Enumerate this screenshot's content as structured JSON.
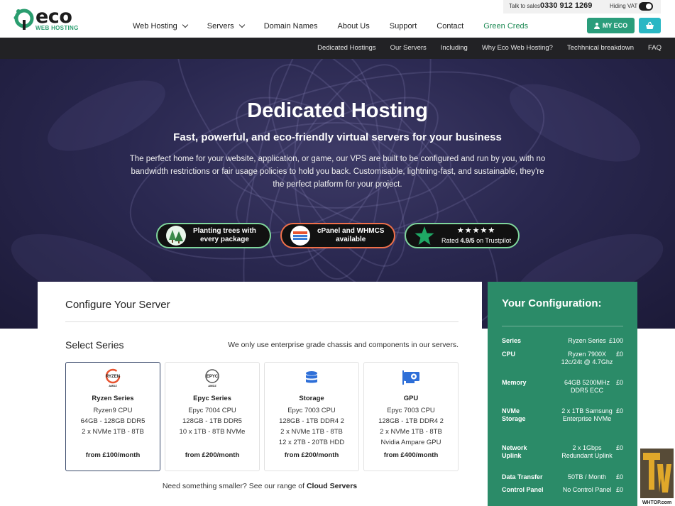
{
  "brand": {
    "word": "eco",
    "sub": "WEB HOSTING"
  },
  "utility": {
    "sales_label": "Talk to sales",
    "phone": "0330 912 1269",
    "vat_label": "Hiding VAT"
  },
  "nav": {
    "items": [
      {
        "label": "Web Hosting",
        "dropdown": true
      },
      {
        "label": "Servers",
        "dropdown": true
      },
      {
        "label": "Domain Names",
        "dropdown": false
      },
      {
        "label": "About Us",
        "dropdown": false
      },
      {
        "label": "Support",
        "dropdown": false
      },
      {
        "label": "Contact",
        "dropdown": false
      },
      {
        "label": "Green Creds",
        "dropdown": false
      }
    ],
    "my_eco_label": "MY ECO"
  },
  "subnav": {
    "links": [
      "Dedicated Hostings",
      "Our Servers",
      "Including",
      "Why Eco Web Hosting?",
      "Techhnical breakdown",
      "FAQ"
    ]
  },
  "hero": {
    "title": "Dedicated Hosting",
    "subtitle": "Fast, powerful, and eco-friendly virtual servers for your business",
    "body": "The perfect home for your website, application, or game, our VPS are built to be configured and run by you, with no bandwidth restrictions or fair usage policies to hold you back. Customisable, lightning-fast, and sustainable, they're the perfect platform for your project.",
    "badges": {
      "trees_line1": "Planting trees with",
      "trees_line2": "every package",
      "cpanel_line1": "cPanel and WHMCS",
      "cpanel_line2": "available",
      "trustpilot_stars": "★★★★★",
      "trustpilot_prefix": "Rated ",
      "trustpilot_rating": "4.9/5",
      "trustpilot_suffix": " on Trustpilot"
    }
  },
  "configure": {
    "title": "Configure Your Server",
    "select_label": "Select Series",
    "note": "We only use enterprise grade chassis and components in our servers.",
    "cards": [
      {
        "name": "Ryzen Series",
        "specs": [
          "Ryzen9 CPU",
          "64GB - 128GB DDR5",
          "2 x NVMe 1TB - 8TB"
        ],
        "price": "from £100/month",
        "icon": "ryzen-logo-icon",
        "icon_text": "RYZEN",
        "icon_sub": "AMDZ",
        "selected": true
      },
      {
        "name": "Epyc Series",
        "specs": [
          "Epyc 7004 CPU",
          "128GB - 1TB DDR5",
          "10 x 1TB - 8TB NVMe"
        ],
        "price": "from £200/month",
        "icon": "epyc-logo-icon",
        "icon_text": "EPYC",
        "icon_sub": "AMDZ",
        "selected": false
      },
      {
        "name": "Storage",
        "specs": [
          "Epyc 7003 CPU",
          "128GB - 1TB DDR4 2",
          "2 x NVMe 1TB - 8TB",
          "12 x 2TB - 20TB HDD"
        ],
        "price": "from £200/month",
        "icon": "database-icon",
        "selected": false
      },
      {
        "name": "GPU",
        "specs": [
          "Epyc 7003 CPU",
          "128GB - 1TB DDR4 2",
          "2 x NVMe 1TB - 8TB",
          "Nvidia Ampare GPU"
        ],
        "price": "from £400/month",
        "icon": "gpu-icon",
        "selected": false
      }
    ],
    "smaller_text": "Need something smaller? See our range of ",
    "smaller_link": "Cloud Servers"
  },
  "your_config": {
    "title": "Your Configuration:",
    "rows": [
      {
        "key": "Series",
        "value": "Ryzen Series",
        "price": "£100"
      },
      {
        "key": "CPU",
        "value": "Ryzen 7900X 12c/24t @ 4.7Ghz",
        "price": "£0"
      },
      {
        "key": "Memory",
        "value": "64GB 5200MHz DDR5 ECC",
        "price": "£0"
      },
      {
        "key": "NVMe Storage",
        "value": "2 x 1TB Samsung Enterprise NVMe",
        "price": "£0"
      },
      {
        "key": "Network Uplink",
        "value": "2 x 1Gbps Redundant Uplink",
        "price": "£0"
      },
      {
        "key": "Data Transfer",
        "value": "50TB / Month",
        "price": "£0"
      },
      {
        "key": "Control Panel",
        "value": "No Control Panel",
        "price": "£0"
      }
    ]
  },
  "watermark": {
    "label": "WHTOP.com"
  },
  "colors": {
    "accent_green": "#2a9d7b",
    "panel_green": "#2b8b68",
    "basket_teal": "#2ab7c4",
    "subnav_dark": "#222225",
    "hero_purple": "#2a2850"
  }
}
